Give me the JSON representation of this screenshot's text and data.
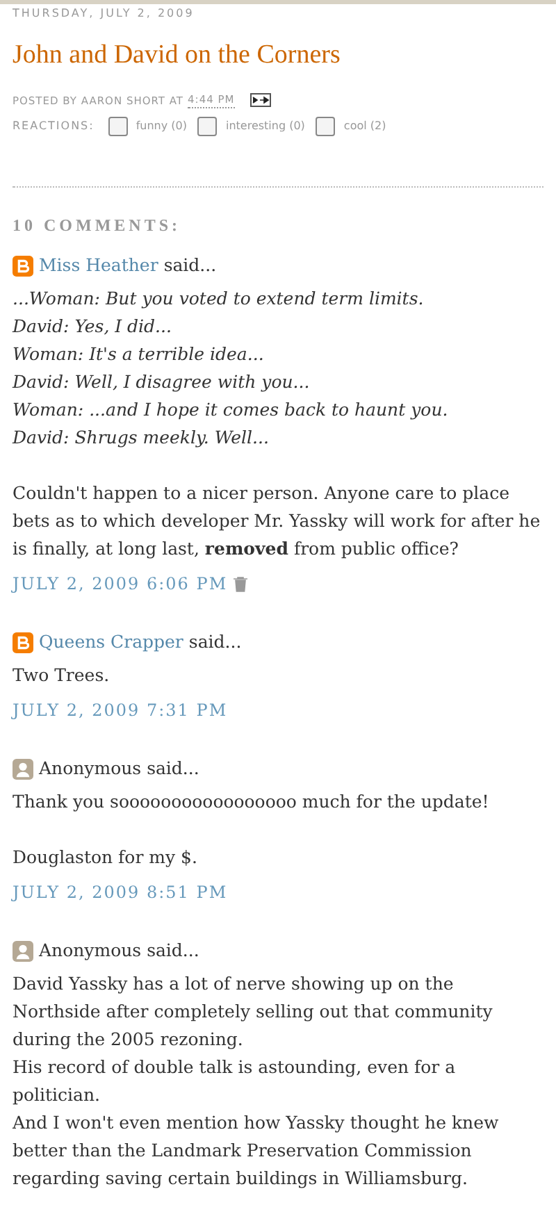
{
  "post": {
    "date_header": "THURSDAY, JULY 2, 2009",
    "title": "John and David on the Corners",
    "byline": "POSTED BY AARON SHORT AT",
    "time": "4:44 PM",
    "reactions_label": "REACTIONS:",
    "reactions": [
      {
        "label": "funny (0)",
        "checked": false
      },
      {
        "label": "interesting (0)",
        "checked": false
      },
      {
        "label": "cool (2)",
        "checked": false
      }
    ]
  },
  "comments_header": "10 COMMENTS:",
  "comments": [
    {
      "kind": "blogger",
      "author": "Miss Heather",
      "said": "said...",
      "paragraphs": [
        {
          "italic": true,
          "lines": [
            "...Woman: But you voted to extend term limits.",
            "David: Yes, I did...",
            "Woman: It's a terrible idea...",
            "David: Well, I disagree with you...",
            "Woman: ...and I hope it comes back to haunt you.",
            "David: Shrugs meekly. Well..."
          ]
        },
        {
          "italic": false,
          "lines": [
            "Couldn't happen to a nicer person. Anyone care to place bets as to which developer Mr. Yassky will work for after he is finally, at long last, **removed** from public office?"
          ]
        }
      ],
      "timestamp": "JULY 2, 2009 6:06 PM",
      "deletable": true
    },
    {
      "kind": "blogger",
      "author": "Queens Crapper",
      "said": "said...",
      "paragraphs": [
        {
          "italic": false,
          "lines": [
            "Two Trees."
          ]
        }
      ],
      "timestamp": "JULY 2, 2009 7:31 PM",
      "deletable": false
    },
    {
      "kind": "anonymous",
      "author": "Anonymous",
      "said": "said...",
      "paragraphs": [
        {
          "italic": false,
          "lines": [
            "Thank you sooooooooooooooooo much for the update!"
          ]
        },
        {
          "italic": false,
          "lines": [
            "Douglaston for my $."
          ]
        }
      ],
      "timestamp": "JULY 2, 2009 8:51 PM",
      "deletable": false
    },
    {
      "kind": "anonymous",
      "author": "Anonymous",
      "said": "said...",
      "paragraphs": [
        {
          "italic": false,
          "lines": [
            "David Yassky has a lot of nerve showing up on the Northside after completely selling out that community during the 2005 rezoning.",
            "His record of double talk is astounding, even for a politician.",
            "And I won't even mention how Yassky thought he knew better than the Landmark Preservation Commission regarding saving certain buildings in Williamsburg."
          ]
        }
      ]
    }
  ]
}
